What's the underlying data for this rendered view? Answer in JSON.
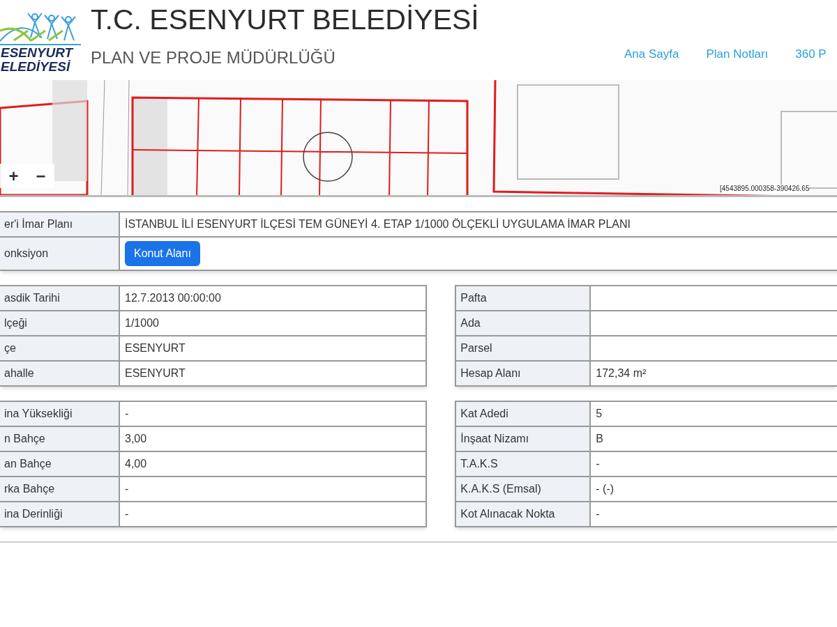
{
  "header": {
    "logo_text": [
      "ESENYURT",
      "ELEDİYESİ"
    ],
    "title": "T.C. ESENYURT BELEDİYESİ",
    "subtitle": "PLAN VE PROJE MÜDÜRLÜĞÜ",
    "nav": [
      "Ana Sayfa",
      "Plan Notları",
      "360 P"
    ]
  },
  "map": {
    "kind": "picture",
    "zoom_in": "+",
    "zoom_out": "−",
    "coordinates": "[4543895.000358-390426.65"
  },
  "plan_table": [
    {
      "label": "er'i İmar Planı",
      "kind": "text",
      "value": "İSTANBUL İLİ ESENYURT İLÇESİ TEM GÜNEYİ 4. ETAP 1/1000 ÖLÇEKLİ UYGULAMA İMAR PLANI"
    },
    {
      "label": "onksiyon",
      "kind": "badge",
      "value": "Konut Alanı"
    }
  ],
  "sections": [
    {
      "left": [
        {
          "label": "asdik Tarihi",
          "value": "12.7.2013 00:00:00"
        },
        {
          "label": "lçeği",
          "value": "1/1000"
        },
        {
          "label": "çe",
          "value": "ESENYURT"
        },
        {
          "label": "ahalle",
          "value": "ESENYURT"
        }
      ],
      "right": [
        {
          "label": "Pafta"
        },
        {
          "label": "Ada"
        },
        {
          "label": "Parsel"
        },
        {
          "label": "Hesap Alanı",
          "value": "172,34 m²"
        }
      ]
    },
    {
      "left": [
        {
          "label": "ina Yüksekliği",
          "value": "-"
        },
        {
          "label": "n Bahçe",
          "value": "3,00"
        },
        {
          "label": "an Bahçe",
          "value": "4,00"
        },
        {
          "label": "rka Bahçe",
          "value": "-"
        },
        {
          "label": "ina Derinliği",
          "value": "-"
        }
      ],
      "right": [
        {
          "label": "Kat Adedi",
          "value": "5"
        },
        {
          "label": "İnşaat Nizamı",
          "value": "B"
        },
        {
          "label": "T.A.K.S",
          "value": "-"
        },
        {
          "label": "K.A.K.S (Emsal)",
          "value": "- (-)"
        },
        {
          "label": "Kot Alınacak Nokta",
          "value": "-"
        }
      ]
    }
  ]
}
